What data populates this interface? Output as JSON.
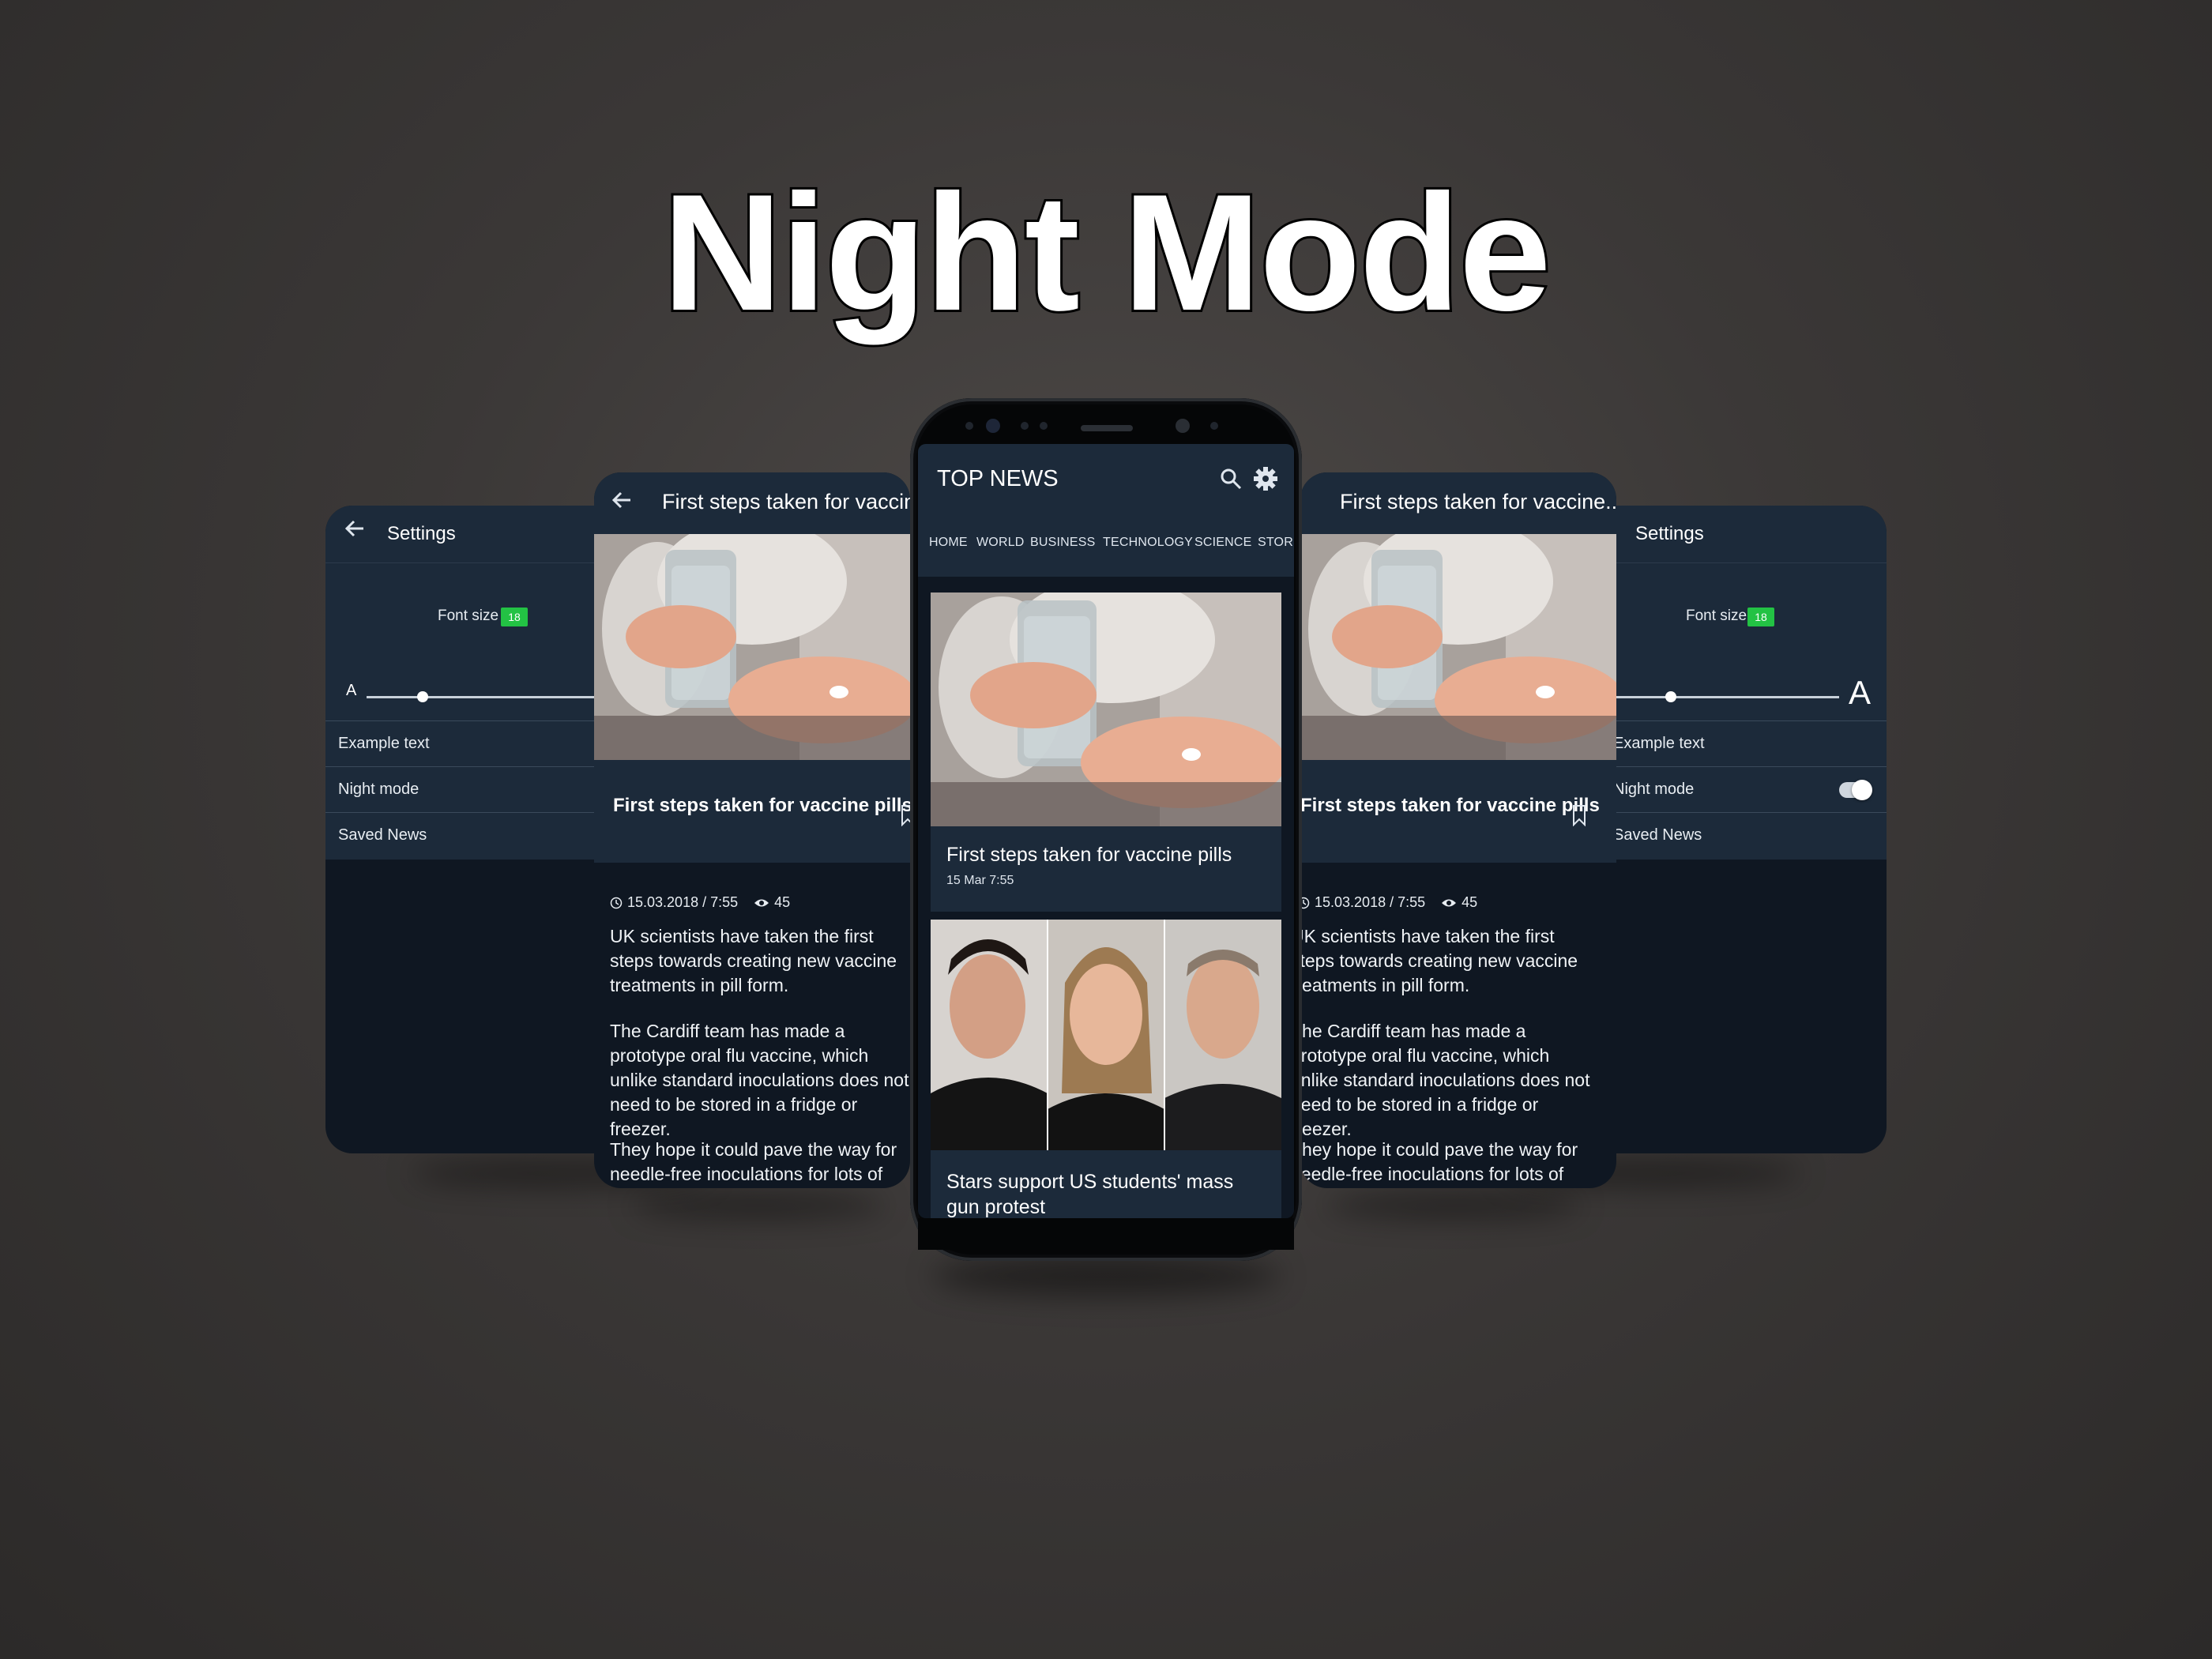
{
  "headline": "Night Mode",
  "colors": {
    "background": "#3b3837",
    "app_bar": "#1c2a3a",
    "screen_bg": "#0f1722",
    "badge": "#23c244",
    "text": "#ffffff"
  },
  "settings": {
    "title": "Settings",
    "font_size_label": "Font size",
    "font_size_value": "18",
    "slider_min_label": "A",
    "slider_max_label": "A",
    "slider_level_fraction": 0.13,
    "rows": {
      "example_text": "Example text",
      "night_mode": "Night mode",
      "saved_news": "Saved News"
    },
    "night_mode_enabled": true
  },
  "article": {
    "header_title": "First steps taken for vaccine...",
    "title": "First steps taken for vaccine pills",
    "date": "15.03.2018 / 7:55",
    "views": "45",
    "paragraphs": [
      "UK scientists have taken the first steps towards creating new vaccine treatments in pill form.",
      "The Cardiff team has made a prototype oral flu vaccine, which unlike standard inoculations does not need to be stored in a fridge or freezer.",
      "They hope it could pave the way for needle-free inoculations for lots of different diseases that would be easier to use in developing countries."
    ]
  },
  "phone": {
    "app_title": "TOP NEWS",
    "icons": [
      "search-icon",
      "gear-icon"
    ],
    "tabs": [
      "HOME",
      "WORLD",
      "BUSINESS",
      "TECHNOLOGY",
      "SCIENCE",
      "STOR"
    ],
    "cards": [
      {
        "title": "First steps taken for vaccine pills",
        "time": "15 Mar 7:55"
      },
      {
        "title": "Stars support US students' mass gun protest"
      }
    ]
  }
}
